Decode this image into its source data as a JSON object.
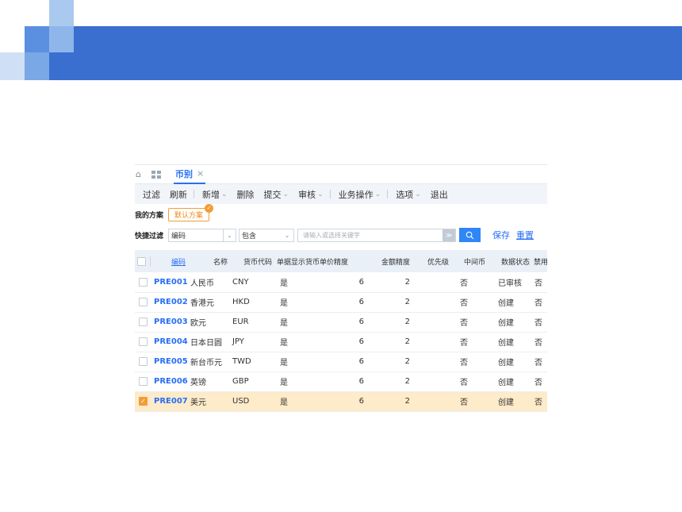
{
  "tabbar": {
    "tab_label": "币别",
    "tab_close": "×"
  },
  "toolbar": {
    "items": [
      "过滤",
      "刷新",
      "新增",
      "删除",
      "提交",
      "审核",
      "业务操作",
      "选项",
      "退出"
    ]
  },
  "scheme": {
    "label": "我的方案",
    "default_label": "默认方案"
  },
  "quick_filter": {
    "label": "快捷过滤",
    "field": "编码",
    "operator": "包含",
    "placeholder": "请输入或选择关键字",
    "save": "保存",
    "reset": "重置"
  },
  "table": {
    "columns": [
      "编码",
      "名称",
      "货币代码",
      "单据显示货币...",
      "单价精度",
      "金额精度",
      "优先级",
      "中间币",
      "数据状态",
      "禁用"
    ],
    "rows": [
      {
        "code": "PRE001",
        "name": "人民币",
        "currency": "CNY",
        "show": "是",
        "price": "6",
        "amount": "2",
        "priority": "",
        "mid": "否",
        "status": "已审核",
        "disabled": "否",
        "checked": false
      },
      {
        "code": "PRE002",
        "name": "香港元",
        "currency": "HKD",
        "show": "是",
        "price": "6",
        "amount": "2",
        "priority": "",
        "mid": "否",
        "status": "创建",
        "disabled": "否",
        "checked": false
      },
      {
        "code": "PRE003",
        "name": "欧元",
        "currency": "EUR",
        "show": "是",
        "price": "6",
        "amount": "2",
        "priority": "",
        "mid": "否",
        "status": "创建",
        "disabled": "否",
        "checked": false
      },
      {
        "code": "PRE004",
        "name": "日本日圆",
        "currency": "JPY",
        "show": "是",
        "price": "6",
        "amount": "2",
        "priority": "",
        "mid": "否",
        "status": "创建",
        "disabled": "否",
        "checked": false
      },
      {
        "code": "PRE005",
        "name": "新台币元",
        "currency": "TWD",
        "show": "是",
        "price": "6",
        "amount": "2",
        "priority": "",
        "mid": "否",
        "status": "创建",
        "disabled": "否",
        "checked": false
      },
      {
        "code": "PRE006",
        "name": "英镑",
        "currency": "GBP",
        "show": "是",
        "price": "6",
        "amount": "2",
        "priority": "",
        "mid": "否",
        "status": "创建",
        "disabled": "否",
        "checked": false
      },
      {
        "code": "PRE007",
        "name": "美元",
        "currency": "USD",
        "show": "是",
        "price": "6",
        "amount": "2",
        "priority": "",
        "mid": "否",
        "status": "创建",
        "disabled": "否",
        "checked": true
      }
    ]
  },
  "colors": {
    "accent": "#276ff5",
    "banner": "#3a6fd0",
    "selected_row": "#fdebc9",
    "scheme_orange": "#f29d38"
  }
}
